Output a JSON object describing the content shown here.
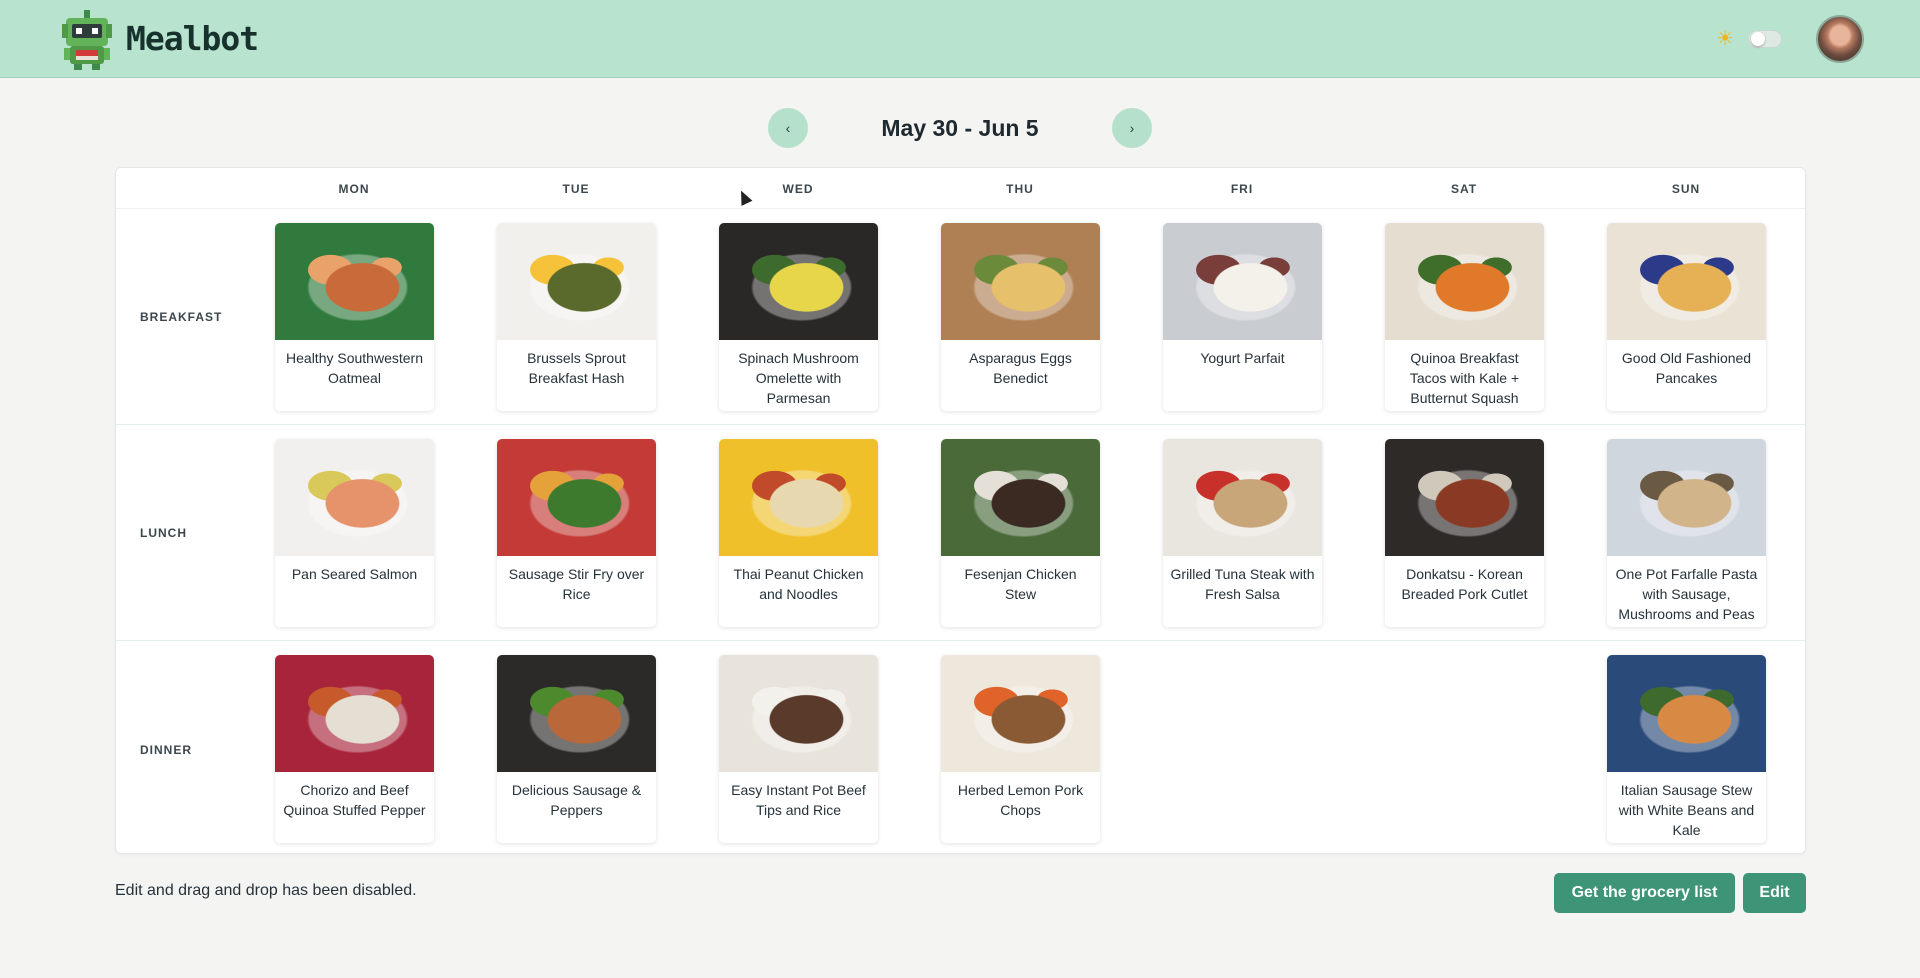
{
  "app": {
    "name": "Mealbot"
  },
  "header": {
    "theme_icon": "sun-icon",
    "theme_toggle_on": false
  },
  "week": {
    "title": "May 30 - Jun 5",
    "prev_icon": "chevron-left-icon",
    "next_icon": "chevron-right-icon",
    "prev_label": "‹",
    "next_label": "›"
  },
  "days": [
    "MON",
    "TUE",
    "WED",
    "THU",
    "FRI",
    "SAT",
    "SUN"
  ],
  "meals": [
    {
      "label": "BREAKFAST",
      "items": [
        {
          "name": "Healthy Southwestern Oatmeal",
          "colors": [
            "#2f7a3c",
            "#c96a3a",
            "#e9a36a"
          ]
        },
        {
          "name": "Brussels Sprout Breakfast Hash",
          "colors": [
            "#f2f0ec",
            "#5a6a2c",
            "#f5c23a"
          ]
        },
        {
          "name": "Spinach Mushroom Omelette with Parmesan",
          "colors": [
            "#2a2826",
            "#e8d64a",
            "#3d6b2e"
          ]
        },
        {
          "name": "Asparagus Eggs Benedict",
          "colors": [
            "#b08055",
            "#e6c06a",
            "#6b8a3a"
          ]
        },
        {
          "name": "Yogurt Parfait",
          "colors": [
            "#c9cdd2",
            "#f4f1ea",
            "#7a3e3a"
          ]
        },
        {
          "name": "Quinoa Breakfast Tacos with Kale + Butternut Squash",
          "colors": [
            "#e4ddd0",
            "#e07a2a",
            "#3f6e2a"
          ]
        },
        {
          "name": "Good Old Fashioned Pancakes",
          "colors": [
            "#eae2d4",
            "#e6b054",
            "#2b3b8a"
          ]
        }
      ]
    },
    {
      "label": "LUNCH",
      "items": [
        {
          "name": "Pan Seared Salmon",
          "colors": [
            "#f1f0ee",
            "#e6926a",
            "#d9c95a"
          ]
        },
        {
          "name": "Sausage Stir Fry over Rice",
          "colors": [
            "#c33a36",
            "#3d7a2e",
            "#e6a23a"
          ]
        },
        {
          "name": "Thai Peanut Chicken and Noodles",
          "colors": [
            "#f0c02a",
            "#e8d8b0",
            "#c04a2a"
          ]
        },
        {
          "name": "Fesenjan Chicken Stew",
          "colors": [
            "#4a6a3a",
            "#3a2a22",
            "#e4e0d8"
          ]
        },
        {
          "name": "Grilled Tuna Steak with Fresh Salsa",
          "colors": [
            "#e9e5df",
            "#c8a67a",
            "#c8302a"
          ]
        },
        {
          "name": "Donkatsu - Korean Breaded Pork Cutlet",
          "colors": [
            "#2e2a28",
            "#8a3a24",
            "#cfc8bb"
          ]
        },
        {
          "name": "One Pot Farfalle Pasta with Sausage, Mushrooms and Peas",
          "colors": [
            "#cfd6de",
            "#d2b48a",
            "#6a5a44"
          ]
        }
      ]
    },
    {
      "label": "DINNER",
      "items": [
        {
          "name": "Chorizo and Beef Quinoa Stuffed Pepper",
          "colors": [
            "#a8243a",
            "#e5dfd3",
            "#c75a2a"
          ]
        },
        {
          "name": "Delicious Sausage & Peppers",
          "colors": [
            "#2b2a28",
            "#b9683a",
            "#4d8a2e"
          ]
        },
        {
          "name": "Easy Instant Pot Beef Tips and Rice",
          "colors": [
            "#e9e4db",
            "#5a3a2a",
            "#f3f1ec"
          ]
        },
        {
          "name": "Herbed Lemon Pork Chops",
          "colors": [
            "#ede7dc",
            "#8a5a34",
            "#e0642a"
          ]
        },
        null,
        null,
        {
          "name": "Italian Sausage Stew with White Beans and Kale",
          "colors": [
            "#2a4a7a",
            "#d88a44",
            "#3f6a2e"
          ]
        }
      ]
    }
  ],
  "footer": {
    "note": "Edit and drag and drop has been disabled.",
    "grocery_label": "Get the grocery list",
    "edit_label": "Edit"
  }
}
